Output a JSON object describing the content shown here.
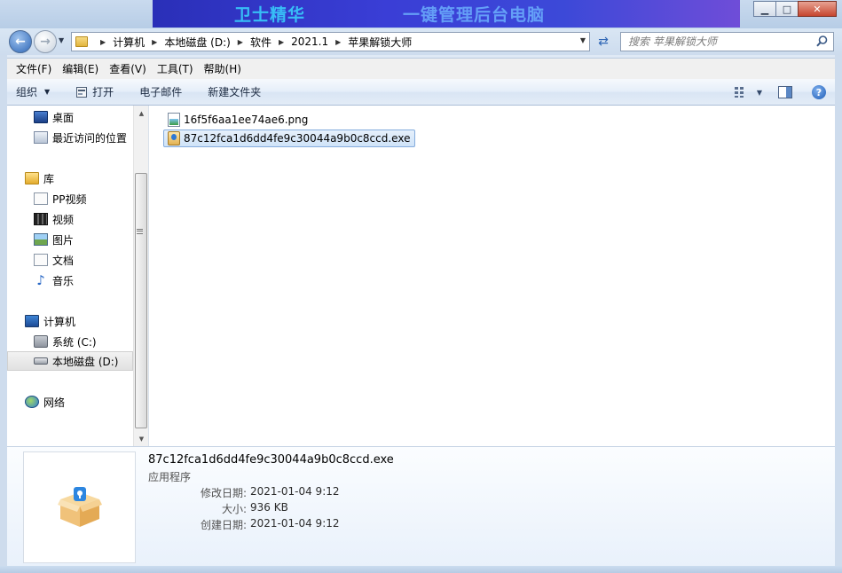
{
  "banner": {
    "text_left": "卫士精华",
    "text_right": "一键管理后台电脑"
  },
  "window_controls": {
    "minimize": "▁",
    "maximize": "□",
    "close": "✕"
  },
  "address": {
    "crumbs": [
      "计算机",
      "本地磁盘 (D:)",
      "软件",
      "2021.1",
      "苹果解锁大师"
    ]
  },
  "search": {
    "placeholder": "搜索 苹果解锁大师"
  },
  "menu": [
    "文件(F)",
    "编辑(E)",
    "查看(V)",
    "工具(T)",
    "帮助(H)"
  ],
  "commands": {
    "organize": "组织",
    "open": "打开",
    "email": "电子邮件",
    "new_folder": "新建文件夹"
  },
  "nav": {
    "favorites": [
      "桌面",
      "最近访问的位置"
    ],
    "library_title": "库",
    "library": [
      "PP视频",
      "视频",
      "图片",
      "文档",
      "音乐"
    ],
    "computer_title": "计算机",
    "drives": [
      "系统 (C:)",
      "本地磁盘 (D:)"
    ],
    "network": "网络"
  },
  "files": [
    {
      "name": "16f5f6aa1ee74ae6.png",
      "icon": "png-file-icon",
      "selected": false
    },
    {
      "name": "87c12fca1d6dd4fe9c30044a9b0c8ccd.exe",
      "icon": "exe-file-icon",
      "selected": true
    }
  ],
  "details": {
    "name": "87c12fca1d6dd4fe9c30044a9b0c8ccd.exe",
    "type": "应用程序",
    "modified_label": "修改日期:",
    "modified": "2021-01-04 9:12",
    "size_label": "大小:",
    "size": "936 KB",
    "created_label": "创建日期:",
    "created": "2021-01-04 9:12"
  }
}
